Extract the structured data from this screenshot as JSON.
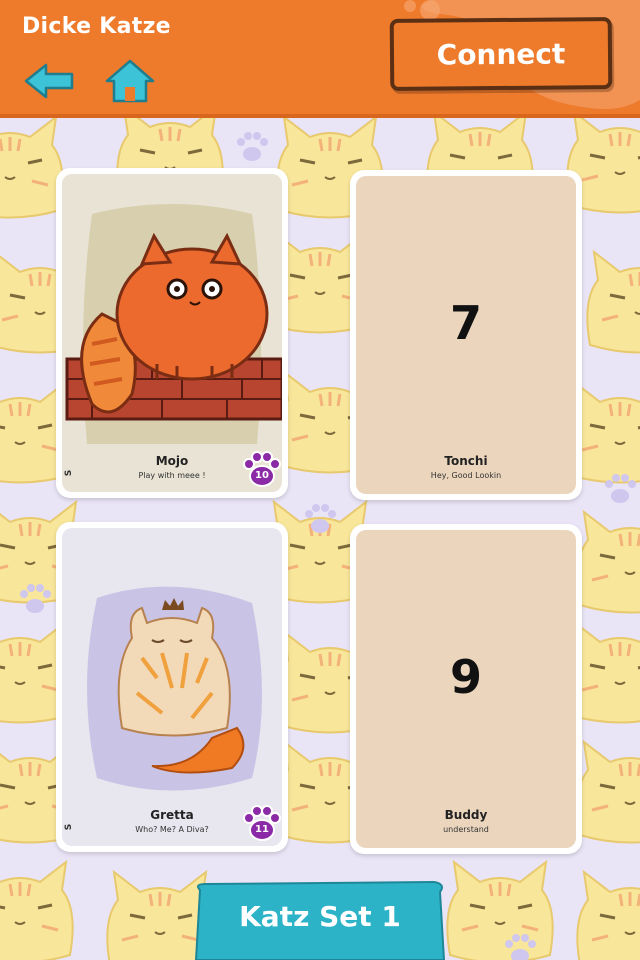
{
  "header": {
    "title": "Dicke Katze",
    "connect_label": "Connect"
  },
  "cards": [
    {
      "name": "Mojo",
      "quote": "Play with meee !",
      "side_label": "S",
      "paw_number": "10",
      "face": "front"
    },
    {
      "name": "Tonchi",
      "quote": "Hey, Good Lookin",
      "number": "7",
      "face": "back"
    },
    {
      "name": "Gretta",
      "quote": "Who? Me? A Diva?",
      "side_label": "S",
      "paw_number": "11",
      "face": "front"
    },
    {
      "name": "Buddy",
      "quote": "understand",
      "number": "9",
      "face": "back"
    }
  ],
  "footer": {
    "set_label": "Katz Set 1"
  },
  "colors": {
    "header_orange": "#ee7a2b",
    "tab_teal": "#2db3c8",
    "paw_purple": "#8b2aa6",
    "background_lavender": "#e9e4f6"
  }
}
